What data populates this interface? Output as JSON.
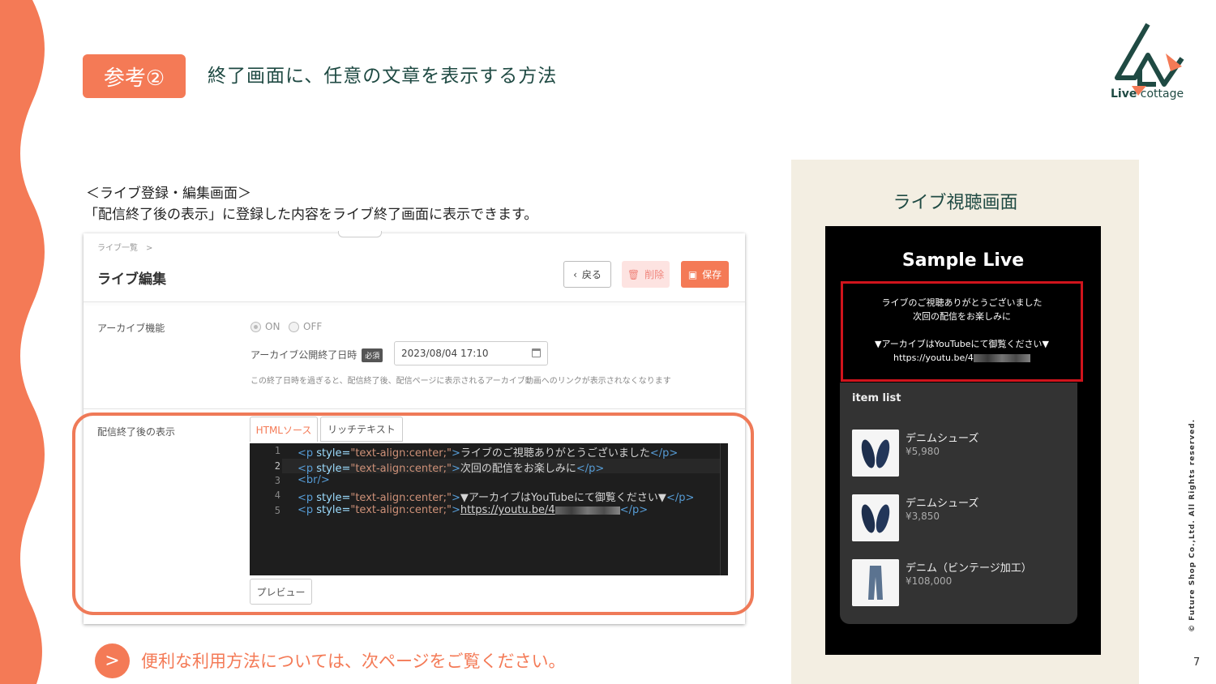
{
  "slide": {
    "badge": "参考②",
    "title": "終了画面に、任意の文章を表示する方法",
    "logo_brand": "Live",
    "logo_suffix": "cottage",
    "section_heading": "＜ライブ登録・編集画面＞",
    "section_desc": "「配信終了後の表示」に登録した内容をライブ終了画面に表示できます。",
    "cta_arrow": ">",
    "cta_text": "便利な利用方法については、次ページをご覧ください。",
    "copyright": "© Future Shop Co.,Ltd. All Rights reserved.",
    "page_number": "7",
    "accent_color": "#f47a56",
    "heading_color": "#1f4a43"
  },
  "editor_screen": {
    "breadcrumb": "ライブ一覧　>",
    "page_title": "ライブ編集",
    "back_label": "戻る",
    "delete_label": "削除",
    "save_label": "保存",
    "archive_label": "アーカイブ機能",
    "radio_on": "ON",
    "radio_off": "OFF",
    "archive_end_label": "アーカイブ公開終了日時",
    "required_badge": "必須",
    "archive_end_value": "2023/08/04 17:10",
    "hint": "この終了日時を過ぎると、配信終了後、配信ページに表示されるアーカイブ動画へのリンクが表示されなくなります",
    "after_label": "配信終了後の表示",
    "tab_html": "HTMLソース",
    "tab_rich": "リッチテキスト",
    "preview_label": "プレビュー",
    "code_lines": [
      {
        "num": "1",
        "open": "<p ",
        "attr": "style=",
        "val": "\"text-align:center;\"",
        "close1": ">",
        "text": "ライブのご視聴ありがとうございました",
        "close2": "</p>"
      },
      {
        "num": "2",
        "open": "<p ",
        "attr": "style=",
        "val": "\"text-align:center;\"",
        "close1": ">",
        "text": "次回の配信をお楽しみに",
        "close2": "</p>"
      },
      {
        "num": "3",
        "open": "<br/>"
      },
      {
        "num": "4",
        "open": "<p ",
        "attr": "style=",
        "val": "\"text-align:center;\"",
        "close1": ">",
        "text": "▼アーカイブはYouTubeにて御覧ください▼",
        "close2": "</p>"
      },
      {
        "num": "5",
        "open": "<p ",
        "attr": "style=",
        "val": "\"text-align:center;\"",
        "close1": ">",
        "text": "https://youtu.be/4",
        "close2": "</p>"
      }
    ]
  },
  "viewer": {
    "section_title": "ライブ視聴画面",
    "live_title": "Sample Live",
    "message_lines": [
      "ライブのご視聴ありがとうございました",
      "次回の配信をお楽しみに",
      "",
      "▼アーカイブはYouTubeにて御覧ください▼",
      "https://youtu.be/4"
    ],
    "item_list_title": "item list",
    "items": [
      {
        "name": "デニムシューズ",
        "price": "¥5,980"
      },
      {
        "name": "デニムシューズ",
        "price": "¥3,850"
      },
      {
        "name": "デニム（ビンテージ加工）",
        "price": "¥108,000"
      }
    ]
  }
}
